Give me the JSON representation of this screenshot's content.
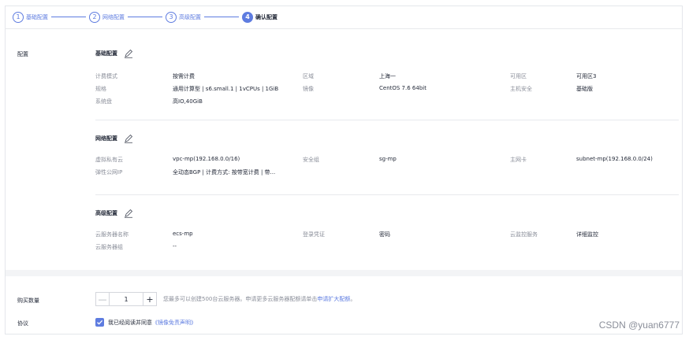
{
  "steps": [
    {
      "num": "1",
      "label": "基础配置"
    },
    {
      "num": "2",
      "label": "网络配置"
    },
    {
      "num": "3",
      "label": "高级配置"
    },
    {
      "num": "4",
      "label": "确认配置"
    }
  ],
  "config_label": "配置",
  "basic": {
    "title": "基础配置",
    "rows": [
      [
        "计费模式",
        "按需计费",
        "区域",
        "上海一",
        "可用区",
        "可用区3"
      ],
      [
        "规格",
        "通用计算型 | s6.small.1 | 1vCPUs | 1GiB",
        "镜像",
        "CentOS 7.6 64bit",
        "主机安全",
        "基础版"
      ],
      [
        "系统盘",
        "高IO,40GiB",
        "",
        "",
        "",
        ""
      ]
    ]
  },
  "network": {
    "title": "网络配置",
    "rows": [
      [
        "虚拟私有云",
        "vpc-mp(192.168.0.0/16)",
        "安全组",
        "sg-mp",
        "主网卡",
        "subnet-mp(192.168.0.0/24)"
      ],
      [
        "弹性公网IP",
        "全动态BGP | 计费方式: 按带宽计费 | 带...",
        "",
        "",
        "",
        ""
      ]
    ]
  },
  "advanced": {
    "title": "高级配置",
    "rows": [
      [
        "云服务器名称",
        "ecs-mp",
        "登录凭证",
        "密码",
        "云监控服务",
        "详细监控"
      ],
      [
        "云服务器组",
        "--",
        "",
        "",
        "",
        ""
      ]
    ]
  },
  "purchase": {
    "label": "购买数量",
    "minus": "—",
    "value": "1",
    "plus": "+",
    "hint_prefix": "您最多可以创建500台云服务器。申请更多云服务器配额请单击",
    "hint_link": "申请扩大配额",
    "hint_suffix": "。"
  },
  "agreement": {
    "label": "协议",
    "text": "我已经阅读并同意",
    "link": "《镜像免责声明》"
  },
  "watermark": "CSDN @yuan6777",
  "colors": {
    "accent": "#5e7ce0",
    "muted": "#8a8e99",
    "text": "#252b3a"
  }
}
